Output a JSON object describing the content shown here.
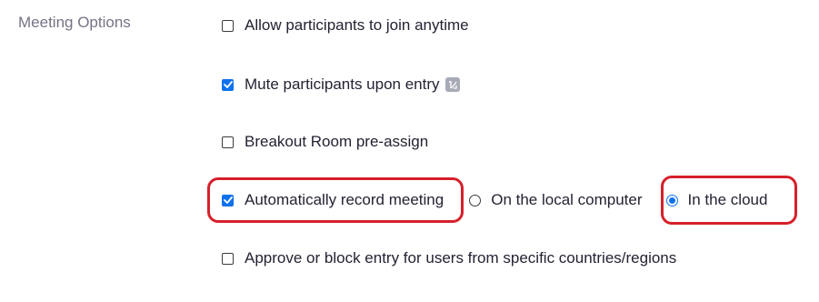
{
  "section": {
    "label": "Meeting Options"
  },
  "options": {
    "join_anytime": {
      "label": "Allow participants to join anytime",
      "checked": false
    },
    "mute_on_entry": {
      "label": "Mute participants upon entry",
      "checked": true,
      "info_icon": "info-icon"
    },
    "breakout_preassign": {
      "label": "Breakout Room pre-assign",
      "checked": false
    },
    "auto_record": {
      "label": "Automatically record meeting",
      "checked": true,
      "choices": [
        {
          "label": "On the local computer",
          "selected": false
        },
        {
          "label": "In the cloud",
          "selected": true
        }
      ]
    },
    "approve_block": {
      "label": "Approve or block entry for users from specific countries/regions",
      "checked": false
    }
  },
  "colors": {
    "accent": "#0e72ed",
    "annotation": "#d6202a",
    "label_gray": "#747487"
  }
}
